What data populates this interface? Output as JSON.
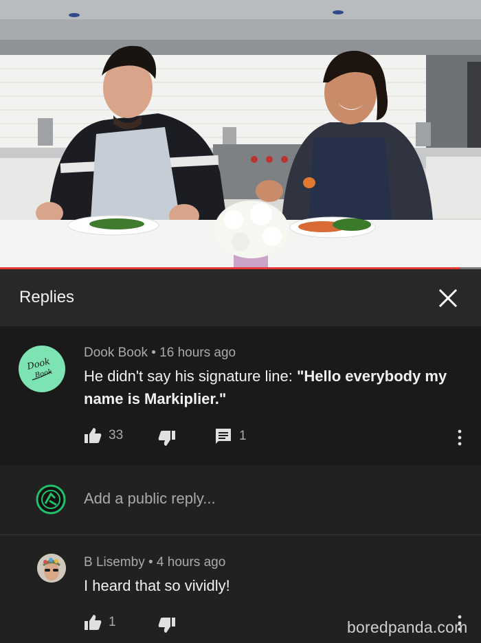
{
  "video": {
    "progress_fraction": 0.957
  },
  "replies_panel": {
    "title": "Replies",
    "close_icon": "close-icon"
  },
  "parent_comment": {
    "avatar_text_line1": "Dook",
    "avatar_text_line2": "Book",
    "author": "Dook Book",
    "separator": "•",
    "time": "16 hours ago",
    "text_plain": "He didn't say his signature line: ",
    "text_bold": "\"Hello everybody my name is Markiplier.\"",
    "likes": "33",
    "replies_count": "1",
    "avatar_color": "#7ee3b2"
  },
  "add_reply": {
    "placeholder": "Add a public reply..."
  },
  "reply_comment": {
    "author": "B Lisemby",
    "separator": "•",
    "time": "4 hours ago",
    "text": "I heard that so vividly!",
    "likes": "1"
  },
  "watermark": "boredpanda.com",
  "colors": {
    "panel_bg": "#212121",
    "header_bg": "#282828",
    "highlight_bg": "#1a1a1a",
    "text_primary": "#f1f1f1",
    "text_secondary": "#aaaaaa",
    "progress": "#e53935"
  }
}
